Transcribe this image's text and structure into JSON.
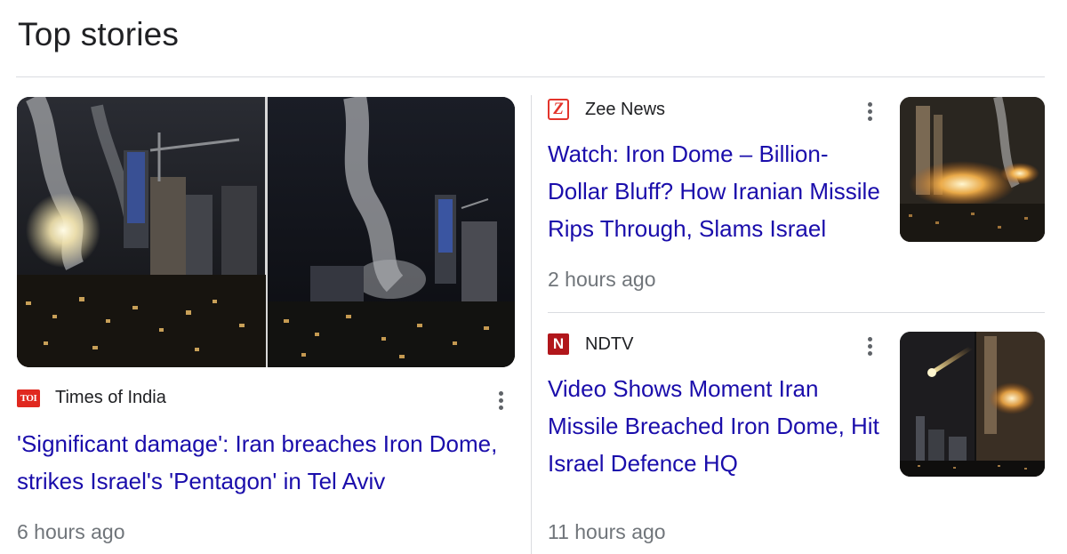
{
  "section": {
    "title": "Top stories"
  },
  "stories": [
    {
      "source": "Times of India",
      "logo_text": "TOI",
      "headline": "'Significant damage': Iran breaches Iron Dome, strikes Israel's 'Pentagon' in Tel Aviv",
      "time": "6 hours ago",
      "logo_color": "#e0281f"
    },
    {
      "source": "Zee News",
      "logo_text": "Z",
      "headline": "Watch: Iron Dome – Billion-Dollar Bluff? How Iranian Missile Rips Through, Slams Israel",
      "time": "2 hours ago",
      "logo_color": "#e3342b"
    },
    {
      "source": "NDTV",
      "logo_text": "N",
      "headline": "Video Shows Moment Iran Missile Breached Iron Dome, Hit Israel Defence HQ",
      "time": "11 hours ago",
      "logo_color": "#b1161b"
    }
  ],
  "colors": {
    "link": "#1a0dab",
    "meta": "#70757a",
    "divider": "#dadce0"
  },
  "icons": {
    "more_options": "more-vert-icon"
  }
}
